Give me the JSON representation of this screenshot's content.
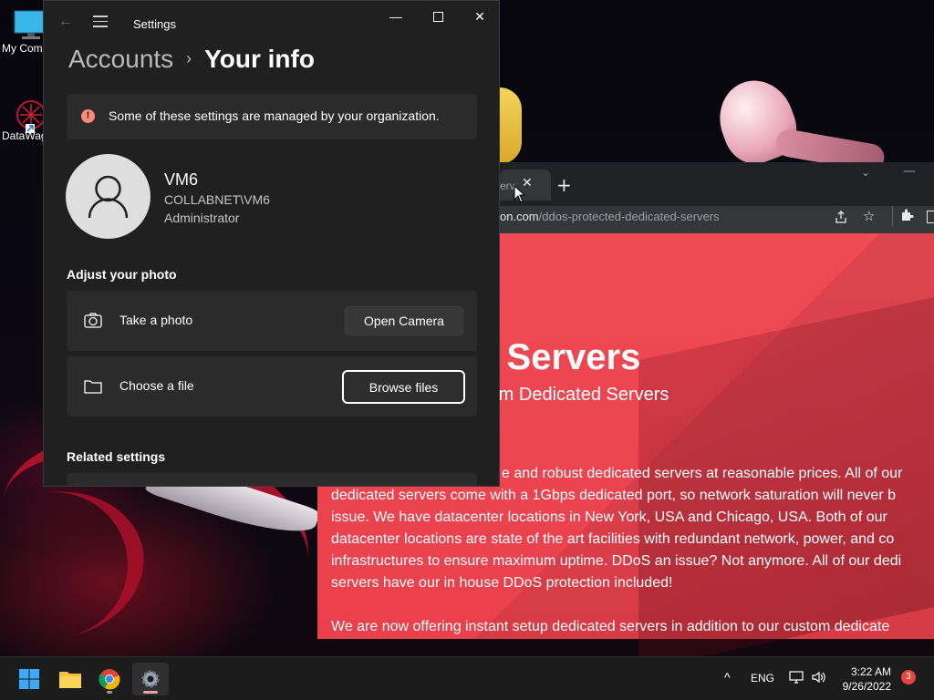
{
  "desktop": {
    "icons": [
      {
        "label": "My Com",
        "icon": "computer-icon"
      },
      {
        "label": "DataWag",
        "icon": "app-shortcut-icon"
      }
    ]
  },
  "browser": {
    "tab_title": "erv",
    "url_domain": "on.com",
    "url_path": "/ddos-protected-dedicated-servers",
    "hero_title": "d Servers",
    "hero_subtitle": "stom Dedicated Servers",
    "paragraph_lines": [
      "e and robust dedicated servers at reasonable prices. All of our",
      "dedicated servers come with a 1Gbps dedicated port, so network saturation will never b",
      "issue. We have datacenter locations in New York, USA and Chicago, USA. Both of our",
      "datacenter locations are state of the art facilities with redundant network, power, and co",
      "infrastructures to ensure maximum uptime. DDoS an issue? Not anymore. All of our dedi",
      "servers have our in house DDoS protection included!"
    ],
    "paragraph2": "We are now offering instant setup dedicated servers in addition to our custom dedicate"
  },
  "settings": {
    "app_title": "Settings",
    "breadcrumb": {
      "parent": "Accounts",
      "current": "Your info"
    },
    "notice": "Some of these settings are managed by your organization.",
    "user": {
      "name": "VM6",
      "domain": "COLLABNET\\VM6",
      "role": "Administrator"
    },
    "adjust_photo_heading": "Adjust your photo",
    "take_photo": {
      "label": "Take a photo",
      "button": "Open Camera"
    },
    "choose_file": {
      "label": "Choose a file",
      "button": "Browse files"
    },
    "related_heading": "Related settings"
  },
  "taskbar": {
    "apps": [
      "start-icon",
      "file-explorer-icon",
      "chrome-icon",
      "settings-icon"
    ],
    "language": "ENG",
    "time": "3:22 AM",
    "date": "9/26/2022",
    "notification_count": "3"
  }
}
